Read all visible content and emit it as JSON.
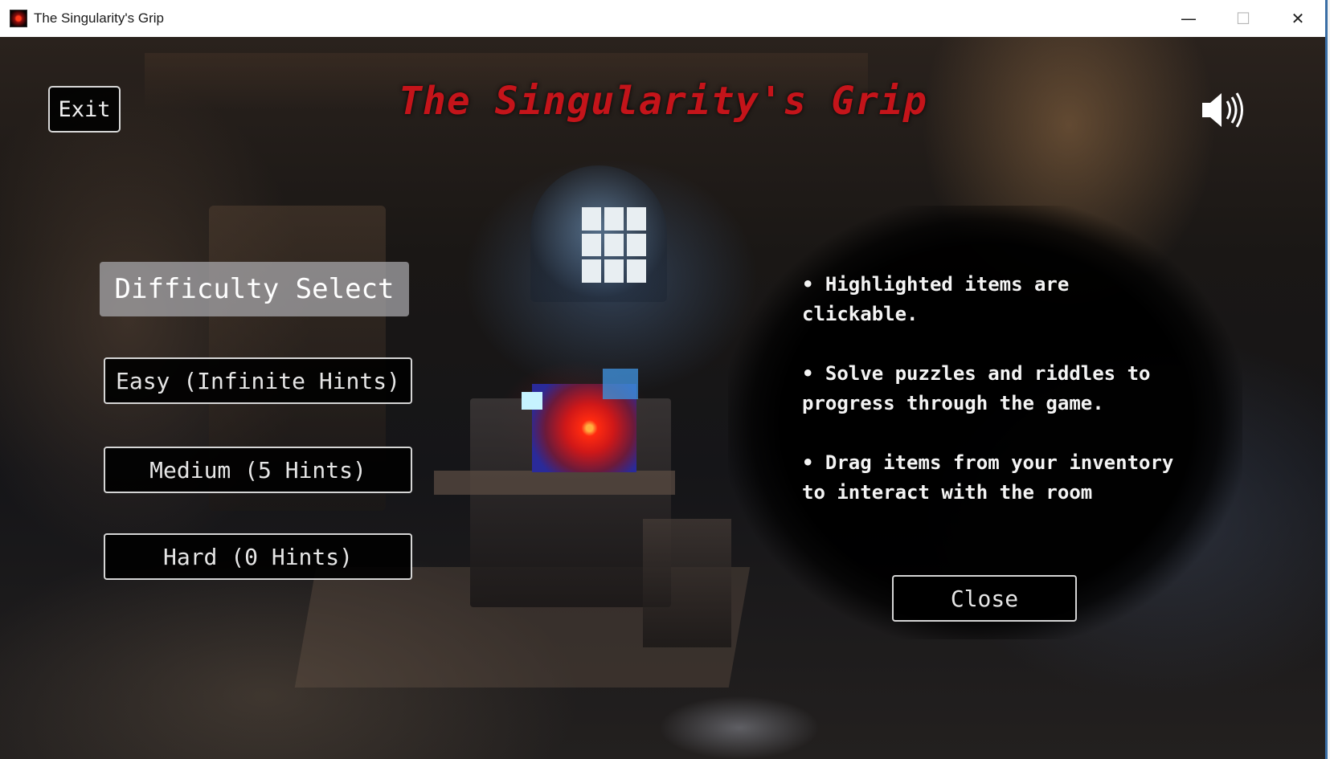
{
  "window": {
    "title": "The Singularity's Grip",
    "app_icon": "singularity-icon",
    "controls": {
      "minimize_glyph": "—",
      "maximize_glyph": "☐",
      "close_glyph": "✕"
    }
  },
  "hud": {
    "exit_label": "Exit",
    "game_title": "The Singularity's Grip",
    "sound_icon": "speaker-on-icon",
    "title_color": "#c4141a"
  },
  "difficulty": {
    "heading": "Difficulty Select",
    "options": [
      {
        "label": "Easy (Infinite Hints)"
      },
      {
        "label": "Medium (5 Hints)"
      },
      {
        "label": "Hard (0 Hints)"
      }
    ]
  },
  "instructions": {
    "items": [
      "• Highlighted items are clickable.",
      "• Solve puzzles and riddles to progress through the game.",
      "• Drag items from your inventory to interact with the room"
    ],
    "close_label": "Close"
  }
}
